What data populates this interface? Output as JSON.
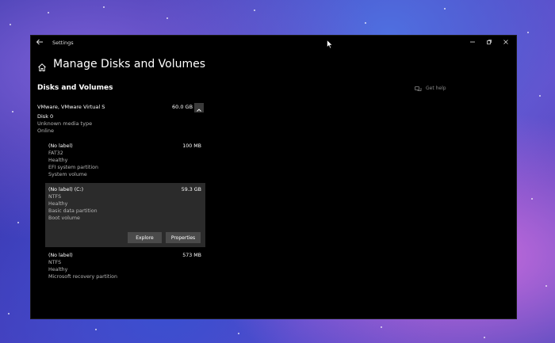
{
  "window": {
    "title": "Settings"
  },
  "page": {
    "title": "Manage Disks and Volumes",
    "section": "Disks and Volumes"
  },
  "help": {
    "label": "Get help"
  },
  "disk": {
    "name": "VMware, VMware Virtual S",
    "size": "60.0 GB",
    "number": "Disk 0",
    "media_type": "Unknown media type",
    "status": "Online"
  },
  "partitions": [
    {
      "name": "(No label)",
      "size": "100 MB",
      "lines": [
        "FAT32",
        "Healthy",
        "EFI system partition",
        "System volume"
      ]
    },
    {
      "name": "(No label) (C:)",
      "size": "59.3 GB",
      "lines": [
        "NTFS",
        "Healthy",
        "Basic data partition",
        "Boot volume"
      ]
    },
    {
      "name": "(No label)",
      "size": "573 MB",
      "lines": [
        "NTFS",
        "Healthy",
        "Microsoft recovery partition"
      ]
    }
  ],
  "buttons": {
    "explore": "Explore",
    "properties": "Properties"
  },
  "icons": {
    "back": "back-arrow-icon",
    "home": "home-icon",
    "help": "chat-help-icon",
    "minimize": "minimize-icon",
    "maximize": "maximize-icon",
    "close": "close-icon",
    "collapse": "chevron-up-icon"
  }
}
